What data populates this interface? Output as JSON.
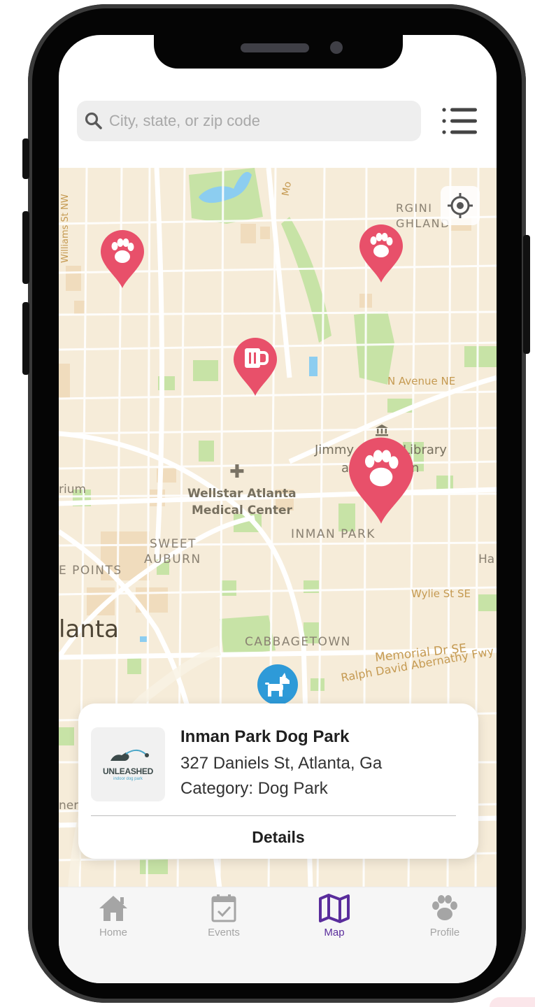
{
  "search": {
    "placeholder": "City, state, or zip code"
  },
  "map": {
    "streets": {
      "williams": "Williams St NW",
      "mo": "Mo",
      "n_avenue": "N Avenue NE",
      "wylie": "Wylie St SE",
      "memorial": "Memorial Dr SE",
      "ralph": "Ralph David Abernathy Fwy"
    },
    "districts": {
      "virginia_1": "RGINI",
      "virginia_2": "GHLAND",
      "inman": "INMAN PARK",
      "sweet": "SWEET",
      "auburn": "AUBURN",
      "points": "E POINTS",
      "cabbagetown": "CABBAGETOWN",
      "ha": "Ha",
      "rium": "rium",
      "ner": "ner"
    },
    "city": "lanta",
    "pois": {
      "wellstar_1": "Wellstar Atlanta",
      "wellstar_2": "Medical Center",
      "jimmy": "Jimmy",
      "library": "Library",
      "a": "a",
      "n": "n"
    },
    "pin_icons": {
      "paw": "paw-icon",
      "beer": "beer-mug-icon",
      "dog": "dog-icon"
    },
    "colors": {
      "pin": "#e8506a",
      "dog_pin": "#2e9ad8",
      "park": "#c7e3a6",
      "water": "#8ccdf0",
      "land": "#f6ecd9"
    }
  },
  "card": {
    "title": "Inman Park Dog Park",
    "address": "327 Daniels St, Atlanta, Ga",
    "category": "Category: Dog Park",
    "logo_text": "UNLEASHED",
    "logo_sub": "indoor dog park",
    "details_label": "Details"
  },
  "tabs": [
    {
      "label": "Home",
      "icon": "home-icon"
    },
    {
      "label": "Events",
      "icon": "calendar-check-icon"
    },
    {
      "label": "Map",
      "icon": "map-icon",
      "active": true
    },
    {
      "label": "Profile",
      "icon": "paw-icon"
    }
  ],
  "colors": {
    "accent": "#5a2d9c",
    "inactive": "#a5a5a5"
  }
}
